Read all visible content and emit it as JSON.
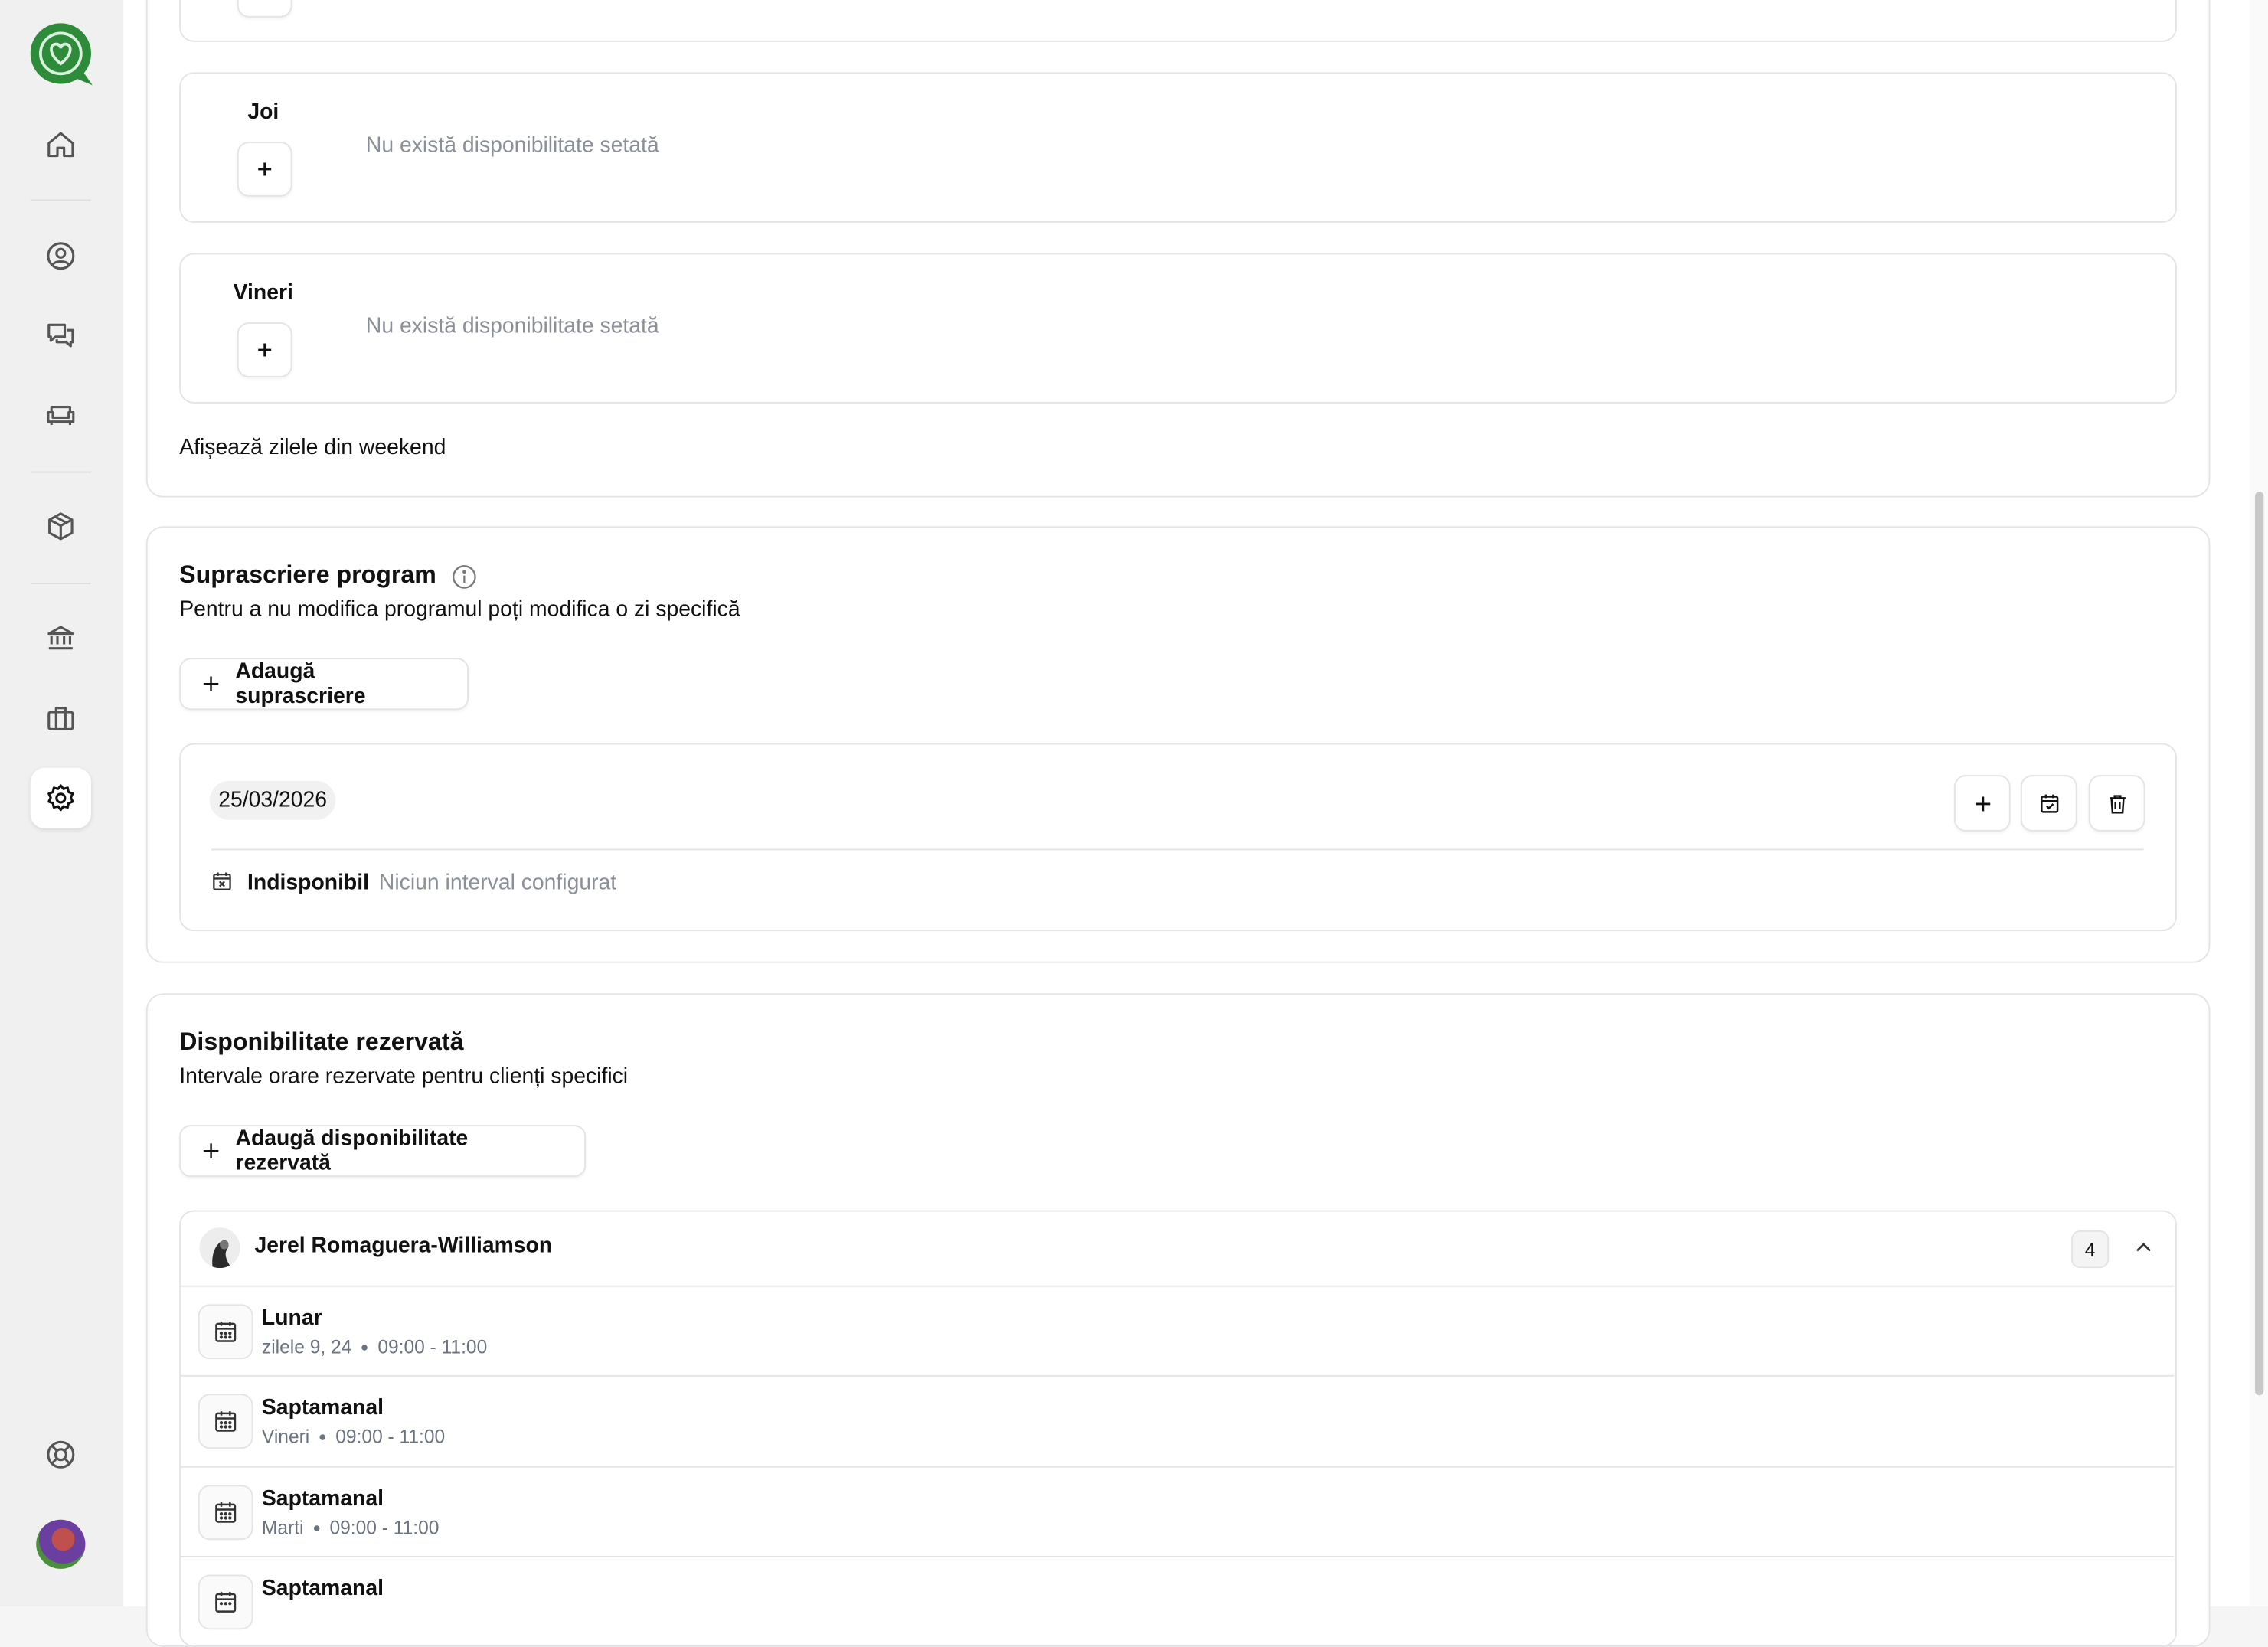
{
  "days": [
    {
      "label": "Joi",
      "empty_text": "Nu există disponibilitate setată"
    },
    {
      "label": "Vineri",
      "empty_text": "Nu există disponibilitate setată"
    }
  ],
  "weekend_toggle_label": "Afișează zilele din weekend",
  "override": {
    "title": "Suprascriere program",
    "subtitle": "Pentru a nu modifica programul poți modifica o zi specifică",
    "add_button": "Adaugă suprascriere",
    "item": {
      "date": "25/03/2026",
      "status": "Indisponibil",
      "status_detail": "Niciun interval configurat"
    }
  },
  "reserved": {
    "title": "Disponibilitate rezervată",
    "subtitle": "Intervale orare rezervate pentru clienți specifici",
    "add_button": "Adaugă disponibilitate rezervată",
    "client": {
      "name": "Jerel Romaguera-Williamson",
      "count": "4"
    },
    "entries": [
      {
        "type": "Lunar",
        "days": "zilele 9, 24",
        "time": "09:00 - 11:00"
      },
      {
        "type": "Saptamanal",
        "days": "Vineri",
        "time": "09:00 - 11:00"
      },
      {
        "type": "Saptamanal",
        "days": "Marti",
        "time": "09:00 - 11:00"
      },
      {
        "type": "Saptamanal",
        "days": "",
        "time": ""
      }
    ]
  },
  "sidebar": {
    "icons": [
      "app-logo",
      "home-icon",
      "user-circle-icon",
      "chat-icon",
      "sofa-icon",
      "package-icon",
      "bank-icon",
      "briefcase-icon",
      "settings-icon",
      "support-icon",
      "avatar"
    ]
  }
}
